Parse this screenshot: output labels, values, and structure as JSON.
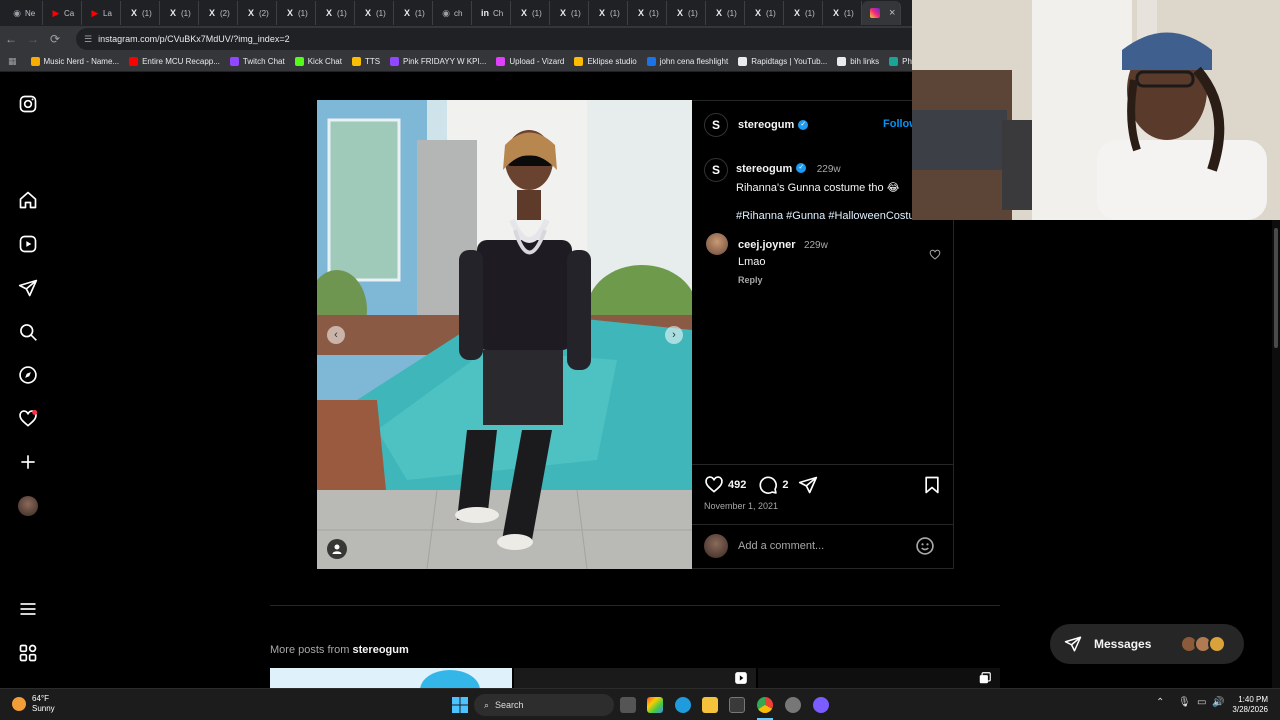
{
  "browser": {
    "tabs": [
      {
        "icon": "chrome-icon",
        "label": "Ne",
        "color": "#9aa0a6"
      },
      {
        "icon": "youtube-icon",
        "label": "Ca",
        "color": "#ff0000"
      },
      {
        "icon": "youtube-icon",
        "label": "La",
        "color": "#ff0000"
      },
      {
        "icon": "x-icon",
        "label": "(1)",
        "color": "#e8eaed"
      },
      {
        "icon": "x-icon",
        "label": "(1)",
        "color": "#e8eaed"
      },
      {
        "icon": "x-icon",
        "label": "(2)",
        "color": "#e8eaed"
      },
      {
        "icon": "x-icon",
        "label": "(2)",
        "color": "#e8eaed"
      },
      {
        "icon": "x-icon",
        "label": "(1)",
        "color": "#e8eaed"
      },
      {
        "icon": "x-icon",
        "label": "(1)",
        "color": "#e8eaed"
      },
      {
        "icon": "x-icon",
        "label": "(1)",
        "color": "#e8eaed"
      },
      {
        "icon": "x-icon",
        "label": "(1)",
        "color": "#e8eaed"
      },
      {
        "icon": "chrome-icon",
        "label": "ch",
        "color": "#9aa0a6"
      },
      {
        "icon": "linkedin-icon",
        "label": "Ch",
        "color": "#e8eaed"
      },
      {
        "icon": "x-icon",
        "label": "(1)",
        "color": "#e8eaed"
      },
      {
        "icon": "x-icon",
        "label": "(1)",
        "color": "#e8eaed"
      },
      {
        "icon": "x-icon",
        "label": "(1)",
        "color": "#e8eaed"
      },
      {
        "icon": "x-icon",
        "label": "(1)",
        "color": "#e8eaed"
      },
      {
        "icon": "x-icon",
        "label": "(1)",
        "color": "#e8eaed"
      },
      {
        "icon": "x-icon",
        "label": "(1)",
        "color": "#e8eaed"
      },
      {
        "icon": "x-icon",
        "label": "(1)",
        "color": "#e8eaed"
      },
      {
        "icon": "x-icon",
        "label": "(1)",
        "color": "#e8eaed"
      },
      {
        "icon": "x-icon",
        "label": "(1)",
        "color": "#e8eaed"
      }
    ],
    "active_tab_close": "×",
    "url": "instagram.com/p/CVuBKx7MdUV/?img_index=2",
    "bookmarks": [
      {
        "label": "Music Nerd - Name...",
        "color": "#f9ab00"
      },
      {
        "label": "Entire MCU Recapp...",
        "color": "#ff0000"
      },
      {
        "label": "Twitch Chat",
        "color": "#9146ff"
      },
      {
        "label": "Kick Chat",
        "color": "#53fc18"
      },
      {
        "label": "TTS",
        "color": "#fbbc04"
      },
      {
        "label": "Pink FRIDAYY W KPI...",
        "color": "#9146ff"
      },
      {
        "label": "Upload - Vizard",
        "color": "#e040fb"
      },
      {
        "label": "Eklipse studio",
        "color": "#fbbc04"
      },
      {
        "label": "john cena fleshlight",
        "color": "#1a73e8"
      },
      {
        "label": "Rapidtags | YouTub...",
        "color": "#e8eaed"
      },
      {
        "label": "bih links",
        "color": "#e8eaed"
      },
      {
        "label": "Photopea",
        "color": "#18a497"
      }
    ]
  },
  "post": {
    "author": "stereogum",
    "follow_label": "Follow",
    "caption_author": "stereogum",
    "caption_age": "229w",
    "caption_text": "Rihanna's Gunna costume tho 😂",
    "hashtags": "#Rihanna #Gunna #HalloweenCostume",
    "comments": [
      {
        "user": "ceej.joyner",
        "age": "229w",
        "text": "Lmao",
        "reply_label": "Reply"
      }
    ],
    "likes": "492",
    "comment_count": "2",
    "date": "November 1, 2021",
    "add_comment_placeholder": "Add a comment..."
  },
  "more_posts": {
    "prefix": "More posts from",
    "user": "stereogum"
  },
  "messages_label": "Messages",
  "taskbar": {
    "weather_temp": "64°F",
    "weather_desc": "Sunny",
    "search_label": "Search",
    "time": "1:40 PM",
    "date": "3/28/2026"
  }
}
